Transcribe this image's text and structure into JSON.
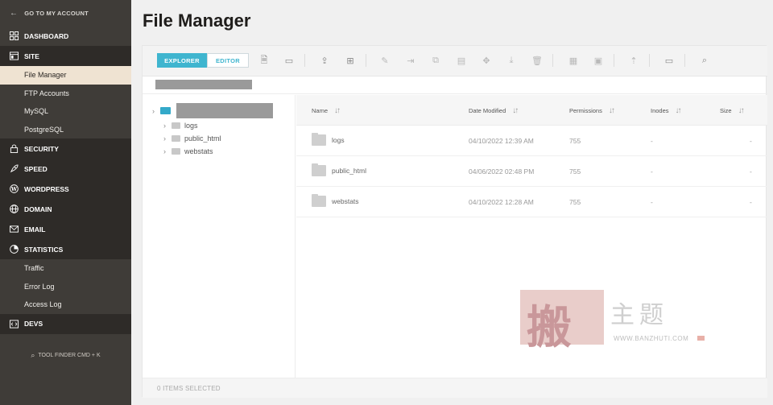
{
  "sidebar": {
    "back_label": "GO TO MY ACCOUNT",
    "sections": [
      {
        "label": "DASHBOARD",
        "icon": "grid-icon"
      },
      {
        "label": "SITE",
        "icon": "site-icon"
      },
      {
        "label": "SECURITY",
        "icon": "lock-icon"
      },
      {
        "label": "SPEED",
        "icon": "rocket-icon"
      },
      {
        "label": "WORDPRESS",
        "icon": "wordpress-icon"
      },
      {
        "label": "DOMAIN",
        "icon": "globe-icon"
      },
      {
        "label": "EMAIL",
        "icon": "mail-icon"
      },
      {
        "label": "STATISTICS",
        "icon": "pie-icon"
      },
      {
        "label": "DEVS",
        "icon": "code-icon"
      }
    ],
    "site_items": [
      "File Manager",
      "FTP Accounts",
      "MySQL",
      "PostgreSQL"
    ],
    "stats_items": [
      "Traffic",
      "Error Log",
      "Access Log"
    ],
    "tool_finder": "TOOL FINDER CMD + K"
  },
  "page_title": "File Manager",
  "tabs": {
    "explorer": "EXPLORER",
    "editor": "EDITOR"
  },
  "tree": {
    "children": [
      "logs",
      "public_html",
      "webstats"
    ]
  },
  "table": {
    "headers": {
      "name": "Name",
      "date": "Date Modified",
      "perm": "Permissions",
      "inodes": "Inodes",
      "size": "Size"
    },
    "rows": [
      {
        "name": "logs",
        "date": "04/10/2022 12:39 AM",
        "perm": "755",
        "inodes": "-",
        "size": "-"
      },
      {
        "name": "public_html",
        "date": "04/06/2022 02:48 PM",
        "perm": "755",
        "inodes": "-",
        "size": "-"
      },
      {
        "name": "webstats",
        "date": "04/10/2022 12:28 AM",
        "perm": "755",
        "inodes": "-",
        "size": "-"
      }
    ]
  },
  "footer": {
    "status": "0 ITEMS SELECTED"
  },
  "watermark": {
    "cn": "搬主题",
    "url": "WWW.BANZHUTI.COM"
  },
  "colors": {
    "accent": "#3fb5cf",
    "sidebar": "#3f3c38",
    "active_item": "#efe3d2"
  }
}
